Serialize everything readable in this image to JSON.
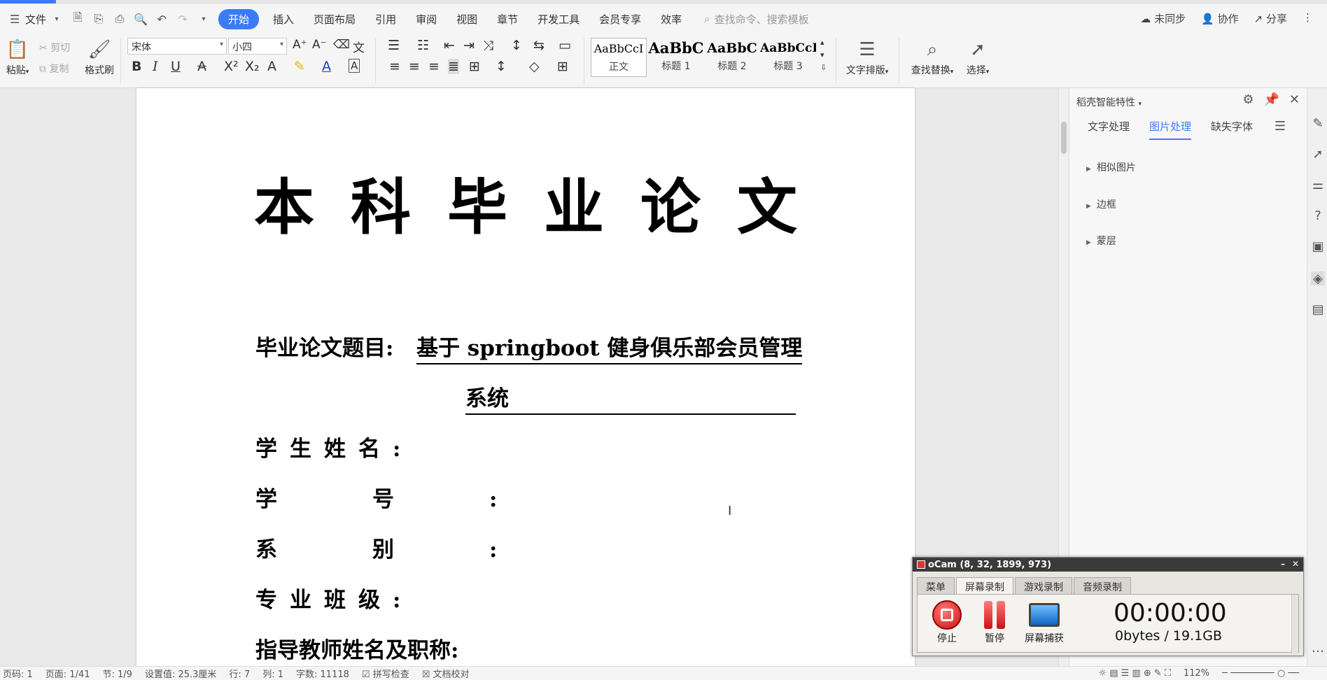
{
  "menubar": {
    "file_label": "文件",
    "tabs": [
      "开始",
      "插入",
      "页面布局",
      "引用",
      "审阅",
      "视图",
      "章节",
      "开发工具",
      "会员专享",
      "效率"
    ],
    "search_placeholder": "查找命令、搜索模板",
    "right_actions": [
      "未同步",
      "协作",
      "分享"
    ]
  },
  "ribbon": {
    "paste_label": "粘贴",
    "cut_label": "剪切",
    "copy_label": "复制",
    "format_painter_label": "格式刷",
    "font_name": "宋体",
    "font_size": "小四",
    "styles": [
      {
        "sample": "AaBbCcI",
        "name": "正文"
      },
      {
        "sample": "AaBbC",
        "name": "标题 1"
      },
      {
        "sample": "AaBbC",
        "name": "标题 2"
      },
      {
        "sample": "AaBbCcI",
        "name": "标题 3"
      }
    ],
    "text_layout_label": "文字排版",
    "find_replace_label": "查找替换",
    "select_label": "选择"
  },
  "document": {
    "title": "本科毕业论文",
    "fields": [
      {
        "label": "毕业论文题目:",
        "value": "基于 springboot 健身俱乐部会员管理",
        "value_cont": "系统"
      },
      {
        "label": "学生姓名:"
      },
      {
        "label": "学号:"
      },
      {
        "label": "系别:"
      },
      {
        "label": "专业班级:"
      },
      {
        "label": "指导教师姓名及职称:"
      }
    ]
  },
  "panel": {
    "title": "稻壳智能特性",
    "tabs": [
      "文字处理",
      "图片处理",
      "缺失字体"
    ],
    "active_tab": "图片处理",
    "sections": [
      "相似图片",
      "边框",
      "蒙层"
    ]
  },
  "ocam": {
    "title": "oCam (8, 32, 1899, 973)",
    "tabs": [
      "菜单",
      "屏幕录制",
      "游戏录制",
      "音频录制"
    ],
    "active_tab": "屏幕录制",
    "stop_label": "停止",
    "pause_label": "暂停",
    "capture_label": "屏幕捕获",
    "timer": "00:00:00",
    "size": "0bytes / 19.1GB"
  },
  "statusbar": {
    "items": [
      "页码: 1",
      "页面: 1/41",
      "节: 1/9",
      "设置值: 25.3厘米",
      "行: 7",
      "列: 1",
      "字数: 11118",
      "拼写检查",
      "文档校对"
    ],
    "zoom": "112%"
  },
  "colors": {
    "accent": "#3b7cf6",
    "menubar_bg": "#f5f5f5",
    "ocam_title_bg": "#3a3a3a"
  }
}
